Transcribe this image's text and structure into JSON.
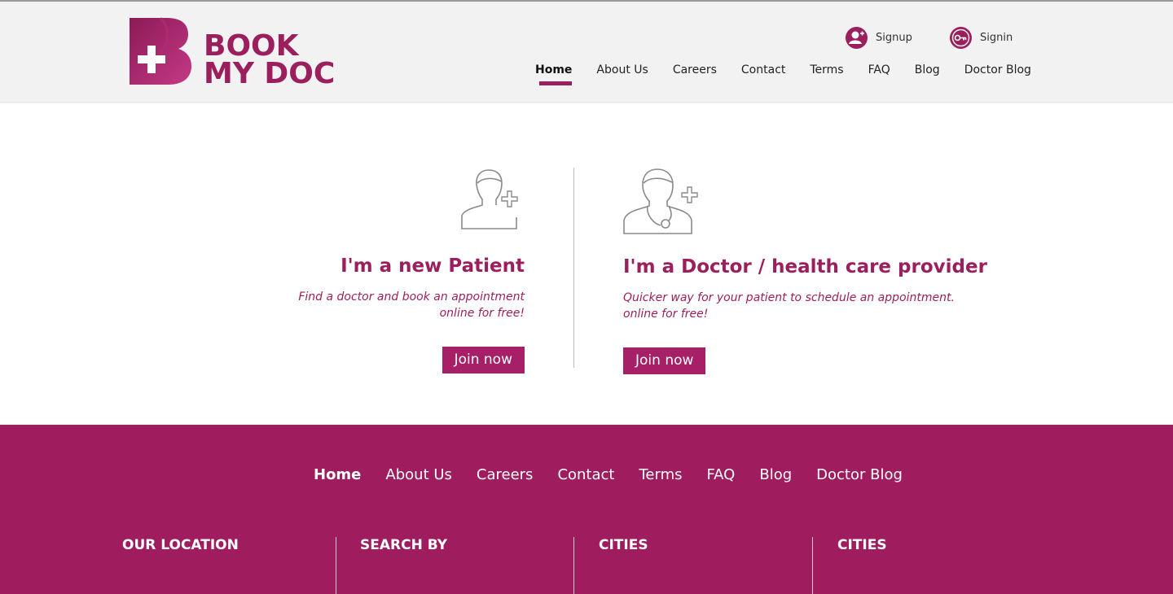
{
  "brand": {
    "line1": "BOOK",
    "line2": "MY DOC",
    "color": "#9c1f5d"
  },
  "auth": {
    "signup": {
      "label": "Signup",
      "icon": "user-add-icon"
    },
    "signin": {
      "label": "Signin",
      "icon": "key-icon"
    }
  },
  "nav": {
    "items": [
      "Home",
      "About Us",
      "Careers",
      "Contact",
      "Terms",
      "FAQ",
      "Blog",
      "Doctor Blog"
    ],
    "active": "Home"
  },
  "patient": {
    "icon": "patient-add-icon",
    "title": "I'm a new Patient",
    "subtitle_line1": "Find a doctor and book an appointment",
    "subtitle_line2": "online for free!",
    "button": "Join now"
  },
  "doctor": {
    "icon": "doctor-add-icon",
    "title": "I'm a Doctor / health care provider",
    "subtitle_line1": "Quicker way for your patient to schedule an appointment.",
    "subtitle_line2": "online for free!",
    "button": "Join now"
  },
  "footer": {
    "nav": [
      "Home",
      "About Us",
      "Careers",
      "Contact",
      "Terms",
      "FAQ",
      "Blog",
      "Doctor Blog"
    ],
    "columns": [
      "OUR LOCATION",
      "SEARCH BY",
      "CITIES",
      "CITIES"
    ],
    "background": "#9f1d5e"
  }
}
